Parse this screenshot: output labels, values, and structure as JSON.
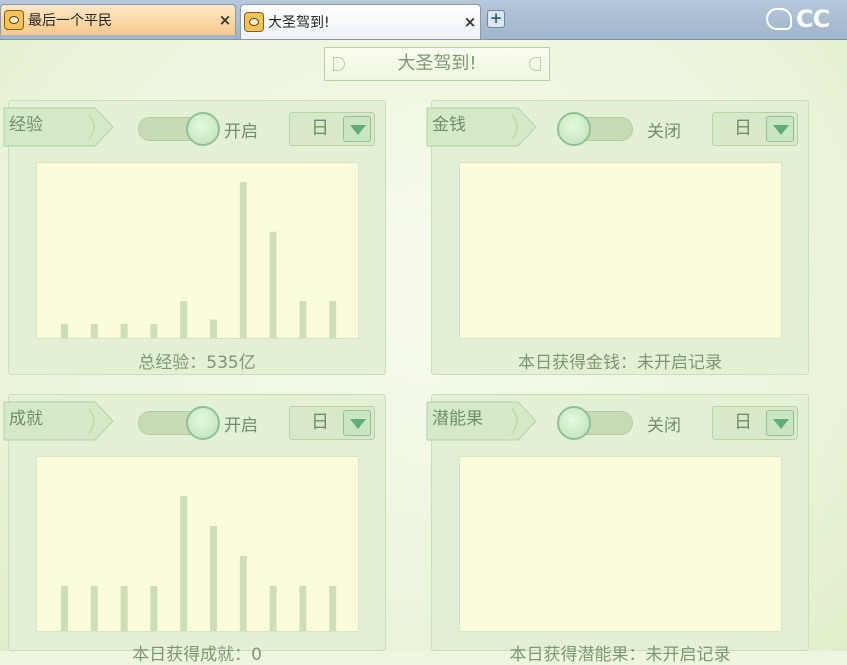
{
  "tabs": [
    {
      "title": "最后一个平民",
      "close": "×"
    },
    {
      "title": "大圣驾到!",
      "close": "×"
    }
  ],
  "new_tab": "+",
  "brand": "CC",
  "page_title": "大圣驾到!",
  "panels": [
    {
      "label": "经验",
      "toggle_text": "开启",
      "toggle_on": true,
      "period": "日",
      "footer": "总经验：535亿",
      "chart_data": {
        "type": "bar",
        "values": [
          1,
          1,
          1,
          1,
          2.6,
          1.3,
          11,
          7.5,
          2.6,
          2.6
        ],
        "ylim": [
          0,
          11.5
        ]
      }
    },
    {
      "label": "金钱",
      "toggle_text": "关闭",
      "toggle_on": false,
      "period": "日",
      "footer": "本日获得金钱：未开启记录",
      "chart_data": {
        "type": "bar",
        "values": [],
        "ylim": [
          0,
          11.5
        ]
      }
    },
    {
      "label": "成就",
      "toggle_text": "开启",
      "toggle_on": true,
      "period": "日",
      "footer": "本日获得成就：0",
      "chart_data": {
        "type": "bar",
        "values": [
          1.5,
          1.5,
          1.5,
          1.5,
          4.5,
          3.5,
          2.5,
          1.5,
          1.5,
          1.5
        ],
        "ylim": [
          0,
          5.4
        ]
      }
    },
    {
      "label": "潜能果",
      "toggle_text": "关闭",
      "toggle_on": false,
      "period": "日",
      "footer": "本日获得潜能果：未开启记录",
      "chart_data": {
        "type": "bar",
        "values": [],
        "ylim": [
          0,
          5.4
        ]
      }
    }
  ]
}
